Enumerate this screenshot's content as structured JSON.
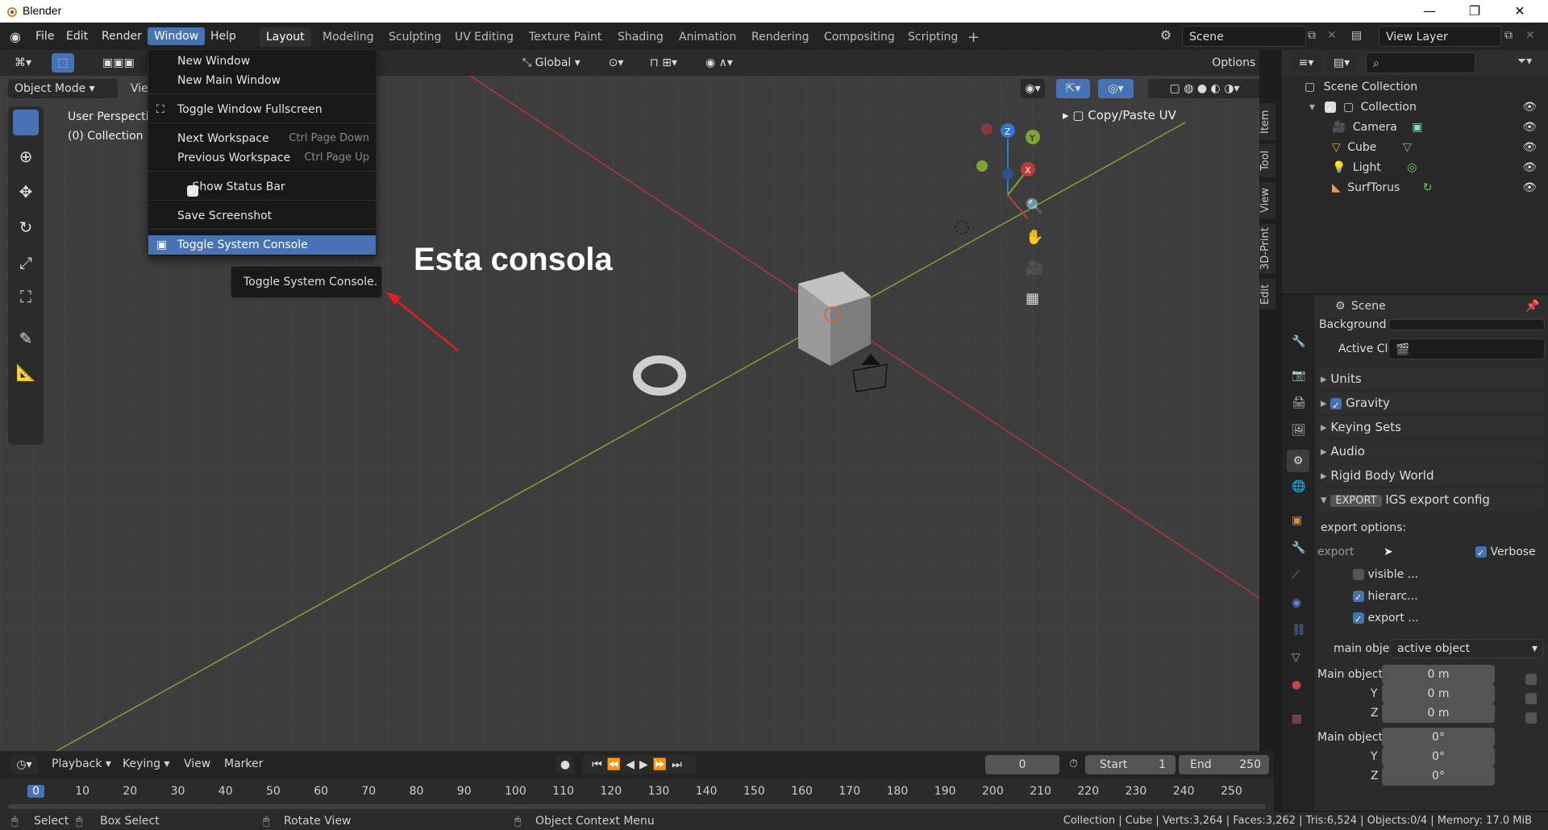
{
  "window_title": "Blender",
  "menubar": [
    "File",
    "Edit",
    "Render",
    "Window",
    "Help"
  ],
  "workspace_tabs": [
    "Layout",
    "Modeling",
    "Sculpting",
    "UV Editing",
    "Texture Paint",
    "Shading",
    "Animation",
    "Rendering",
    "Compositing",
    "Scripting"
  ],
  "active_workspace": "Layout",
  "scene_name": "Scene",
  "view_layer": "View Layer",
  "viewport": {
    "mode": "Object Mode",
    "view_menu": "View",
    "view_name": "User Perspective",
    "collection_info": "(0) Collection | Cube",
    "orientation": "Global",
    "options_label": "Options",
    "panel_label": "Copy/Paste UV"
  },
  "sidebar_tabs": [
    "Item",
    "Tool",
    "View",
    "3D-Print",
    "Edit"
  ],
  "window_menu": {
    "items": [
      {
        "label": "New Window",
        "shortcut": ""
      },
      {
        "label": "New Main Window",
        "shortcut": ""
      },
      {
        "label": "Toggle Window Fullscreen",
        "shortcut": ""
      },
      {
        "label": "Next Workspace",
        "shortcut": "Ctrl Page Down"
      },
      {
        "label": "Previous Workspace",
        "shortcut": "Ctrl Page Up"
      },
      {
        "label": "Show Status Bar",
        "shortcut": ""
      },
      {
        "label": "Save Screenshot",
        "shortcut": ""
      },
      {
        "label": "Toggle System Console",
        "shortcut": ""
      }
    ]
  },
  "tooltip": "Toggle System Console.",
  "annotation": "Esta consola",
  "outliner": {
    "root": "Scene Collection",
    "collection": "Collection",
    "objects": [
      "Camera",
      "Cube",
      "Light",
      "SurfTorus"
    ]
  },
  "properties": {
    "header": "Scene",
    "bg_label": "Background S...",
    "active_clip": "Active Clip",
    "panels": [
      "Units",
      "Gravity",
      "Keying Sets",
      "Audio",
      "Rigid Body World"
    ],
    "export_badge": "EXPORT",
    "export_title": "IGS export config",
    "export_options": "export options:",
    "export_label": "export",
    "verbose": "Verbose",
    "visible": "visible ...",
    "hierarchy": "hierarc...",
    "export_sub": "export ...",
    "main_object_label": "main object",
    "main_object_value": "active object",
    "loc_label": "Main object ...",
    "loc_values": [
      "0 m",
      "0 m",
      "0 m"
    ],
    "rot_label": "Main object ...",
    "rot_values": [
      "0°",
      "0°",
      "0°"
    ],
    "axis_y": "Y",
    "axis_z": "Z"
  },
  "timeline": {
    "menus": [
      "Playback",
      "Keying",
      "View",
      "Marker"
    ],
    "current_frame": "0",
    "start_label": "Start",
    "start": "1",
    "end_label": "End",
    "end": "250",
    "ruler": [
      "0",
      "10",
      "20",
      "30",
      "40",
      "50",
      "60",
      "70",
      "80",
      "90",
      "100",
      "110",
      "120",
      "130",
      "140",
      "150",
      "160",
      "170",
      "180",
      "190",
      "200",
      "210",
      "220",
      "230",
      "240",
      "250"
    ]
  },
  "statusbar": {
    "select": "Select",
    "box_select": "Box Select",
    "rotate_view": "Rotate View",
    "context_menu": "Object Context Menu",
    "stats": "Collection | Cube | Verts:3,264 | Faces:3,262 | Tris:6,524 | Objects:0/4 | Memory: 17.0 MiB"
  },
  "colors": {
    "accent": "#4772b3",
    "x_axis": "#c0393b",
    "y_axis": "#7ea534",
    "z_axis": "#2f78d6"
  }
}
